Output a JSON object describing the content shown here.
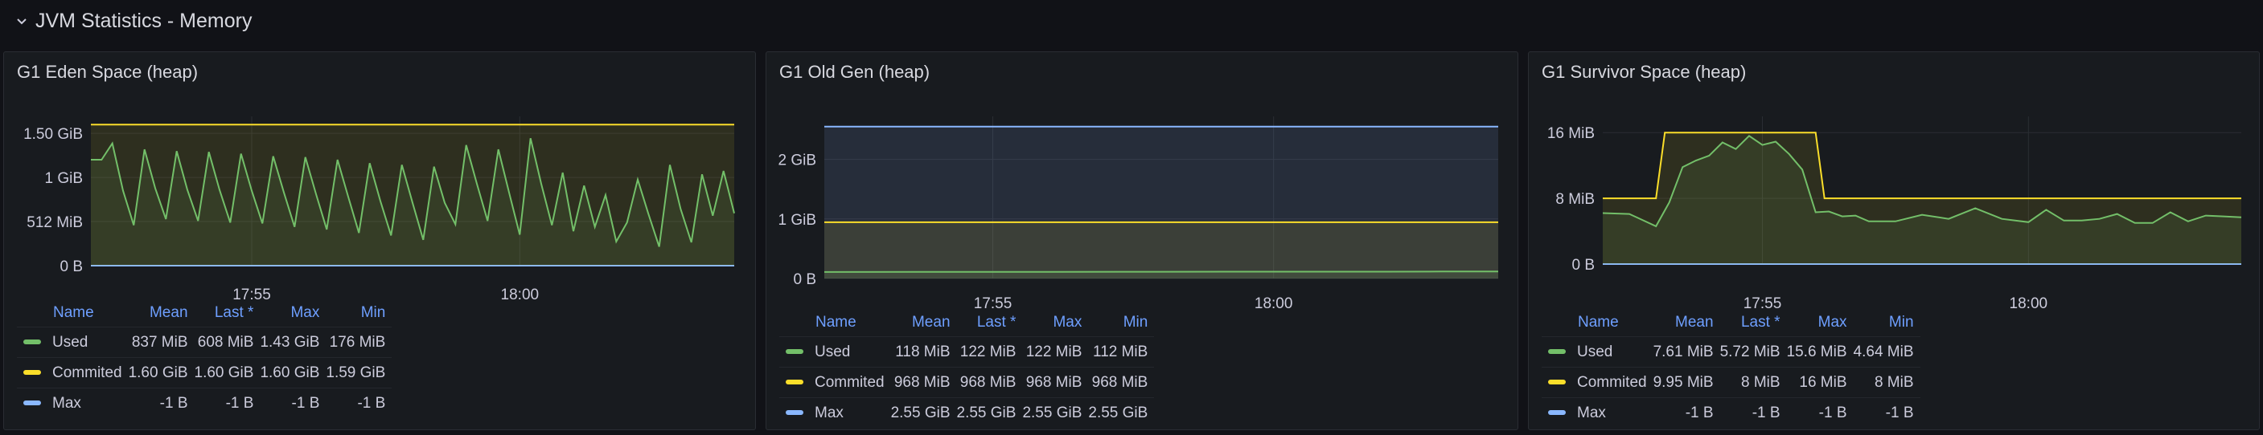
{
  "row": {
    "title": "JVM Statistics - Memory",
    "toggle_icon": "chevron-down-icon"
  },
  "colors": {
    "used": "#73bf69",
    "commited": "#fade2a",
    "max": "#8ab8ff"
  },
  "legend_headers": {
    "name": "Name",
    "mean": "Mean",
    "last": "Last *",
    "max": "Max",
    "min": "Min"
  },
  "panels": [
    {
      "title": "G1 Eden Space (heap)",
      "rows": [
        {
          "name": "Used",
          "mean": "837 MiB",
          "last": "608 MiB",
          "max": "1.43 GiB",
          "min": "176 MiB"
        },
        {
          "name": "Commited",
          "mean": "1.60 GiB",
          "last": "1.60 GiB",
          "max": "1.60 GiB",
          "min": "1.59 GiB"
        },
        {
          "name": "Max",
          "mean": "-1 B",
          "last": "-1 B",
          "max": "-1 B",
          "min": "-1 B"
        }
      ]
    },
    {
      "title": "G1 Old Gen (heap)",
      "rows": [
        {
          "name": "Used",
          "mean": "118 MiB",
          "last": "122 MiB",
          "max": "122 MiB",
          "min": "112 MiB"
        },
        {
          "name": "Commited",
          "mean": "968 MiB",
          "last": "968 MiB",
          "max": "968 MiB",
          "min": "968 MiB"
        },
        {
          "name": "Max",
          "mean": "2.55 GiB",
          "last": "2.55 GiB",
          "max": "2.55 GiB",
          "min": "2.55 GiB"
        }
      ]
    },
    {
      "title": "G1 Survivor Space (heap)",
      "rows": [
        {
          "name": "Used",
          "mean": "7.61 MiB",
          "last": "5.72 MiB",
          "max": "15.6 MiB",
          "min": "4.64 MiB"
        },
        {
          "name": "Commited",
          "mean": "9.95 MiB",
          "last": "8 MiB",
          "max": "16 MiB",
          "min": "8 MiB"
        },
        {
          "name": "Max",
          "mean": "-1 B",
          "last": "-1 B",
          "max": "-1 B",
          "min": "-1 B"
        }
      ]
    }
  ],
  "chart_data": [
    {
      "type": "area",
      "title": "G1 Eden Space (heap)",
      "unit": "MiB",
      "x_ticks": [
        "17:55",
        "18:00"
      ],
      "y_ticks": [
        {
          "value": 0,
          "label": "0 B"
        },
        {
          "value": 512,
          "label": "512 MiB"
        },
        {
          "value": 1024,
          "label": "1 GiB"
        },
        {
          "value": 1536,
          "label": "1.50 GiB"
        }
      ],
      "ylim": [
        0,
        1640
      ],
      "x_range": [
        "17:52",
        "18:04"
      ],
      "series": [
        {
          "name": "Used",
          "color_key": "used",
          "x": [
            "17:52:00",
            "17:52:12",
            "17:52:24",
            "17:52:36",
            "17:52:48",
            "17:53:00",
            "17:53:12",
            "17:53:24",
            "17:53:36",
            "17:53:48",
            "17:54:00",
            "17:54:12",
            "17:54:24",
            "17:54:36",
            "17:54:48",
            "17:55:00",
            "17:55:12",
            "17:55:24",
            "17:55:36",
            "17:55:48",
            "17:56:00",
            "17:56:12",
            "17:56:24",
            "17:56:36",
            "17:56:48",
            "17:57:00",
            "17:57:12",
            "17:57:24",
            "17:57:36",
            "17:57:48",
            "17:58:00",
            "17:58:12",
            "17:58:24",
            "17:58:36",
            "17:58:48",
            "17:59:00",
            "17:59:12",
            "17:59:24",
            "17:59:36",
            "17:59:48",
            "18:00:00",
            "18:00:12",
            "18:00:24",
            "18:00:36",
            "18:00:48",
            "18:01:00",
            "18:01:12",
            "18:01:24",
            "18:01:36",
            "18:01:48",
            "18:02:00",
            "18:02:12",
            "18:02:24",
            "18:02:36",
            "18:02:48",
            "18:03:00",
            "18:03:12",
            "18:03:24",
            "18:03:36",
            "18:03:48",
            "18:04:00"
          ],
          "values": [
            1230,
            1230,
            1420,
            870,
            470,
            1350,
            900,
            540,
            1330,
            880,
            520,
            1320,
            880,
            500,
            1300,
            870,
            490,
            1270,
            850,
            450,
            1260,
            830,
            420,
            1230,
            800,
            380,
            1190,
            750,
            350,
            1170,
            730,
            300,
            1150,
            730,
            480,
            1400,
            950,
            520,
            1350,
            850,
            360,
            1480,
            950,
            470,
            1080,
            400,
            930,
            450,
            820,
            280,
            500,
            1000,
            600,
            220,
            1170,
            660,
            270,
            1060,
            580,
            1100,
            608
          ]
        },
        {
          "name": "Commited",
          "color_key": "commited",
          "constant": 1638
        },
        {
          "name": "Max",
          "color_key": "max",
          "constant": -1,
          "note": ""
        }
      ]
    },
    {
      "type": "area",
      "title": "G1 Old Gen (heap)",
      "unit": "MiB",
      "x_ticks": [
        "17:55",
        "18:00"
      ],
      "y_ticks": [
        {
          "value": 0,
          "label": "0 B"
        },
        {
          "value": 1024,
          "label": "1 GiB"
        },
        {
          "value": 2048,
          "label": "2 GiB"
        }
      ],
      "ylim": [
        0,
        2650
      ],
      "x_range": [
        "17:52",
        "18:04"
      ],
      "series": [
        {
          "name": "Used",
          "color_key": "used",
          "x": [
            "17:52:00",
            "17:54:00",
            "17:56:00",
            "17:58:00",
            "18:00:00",
            "18:02:00",
            "18:03:00",
            "18:04:00"
          ],
          "values": [
            112,
            114,
            115,
            116,
            117,
            118,
            120,
            122
          ]
        },
        {
          "name": "Commited",
          "color_key": "commited",
          "constant": 968
        },
        {
          "name": "Max",
          "color_key": "max",
          "constant": 2611
        }
      ]
    },
    {
      "type": "area",
      "title": "G1 Survivor Space (heap)",
      "unit": "MiB",
      "x_ticks": [
        "17:55",
        "18:00"
      ],
      "y_ticks": [
        {
          "value": 0,
          "label": "0 B"
        },
        {
          "value": 8,
          "label": "8 MiB"
        },
        {
          "value": 16,
          "label": "16 MiB"
        }
      ],
      "ylim": [
        0,
        17
      ],
      "x_range": [
        "17:52",
        "18:04"
      ],
      "series": [
        {
          "name": "Used",
          "color_key": "used",
          "x": [
            "17:52:00",
            "17:52:30",
            "17:53:00",
            "17:53:15",
            "17:53:30",
            "17:53:45",
            "17:54:00",
            "17:54:15",
            "17:54:30",
            "17:54:45",
            "17:55:00",
            "17:55:15",
            "17:55:30",
            "17:55:45",
            "17:56:00",
            "17:56:15",
            "17:56:30",
            "17:56:45",
            "17:57:00",
            "17:57:30",
            "17:58:00",
            "17:58:30",
            "17:59:00",
            "17:59:30",
            "18:00:00",
            "18:00:20",
            "18:00:40",
            "18:01:00",
            "18:01:20",
            "18:01:40",
            "18:02:00",
            "18:02:20",
            "18:02:40",
            "18:03:00",
            "18:03:20",
            "18:03:40",
            "18:04:00"
          ],
          "values": [
            6.2,
            6.1,
            4.6,
            7.5,
            11.8,
            12.6,
            13.2,
            14.8,
            14.0,
            15.6,
            14.5,
            14.9,
            13.4,
            11.5,
            6.3,
            6.4,
            5.8,
            5.9,
            5.2,
            5.2,
            6.0,
            5.5,
            6.8,
            5.5,
            5.1,
            6.6,
            5.3,
            5.3,
            5.5,
            6.1,
            5.0,
            5.0,
            6.3,
            5.2,
            5.9,
            5.8,
            5.7
          ]
        },
        {
          "name": "Commited",
          "color_key": "commited",
          "x": [
            "17:52:00",
            "17:53:00",
            "17:53:10",
            "17:56:00",
            "17:56:10",
            "18:04:00"
          ],
          "values": [
            8,
            8,
            16,
            16,
            8,
            8
          ]
        },
        {
          "name": "Max",
          "color_key": "max",
          "constant": -1
        }
      ]
    }
  ]
}
